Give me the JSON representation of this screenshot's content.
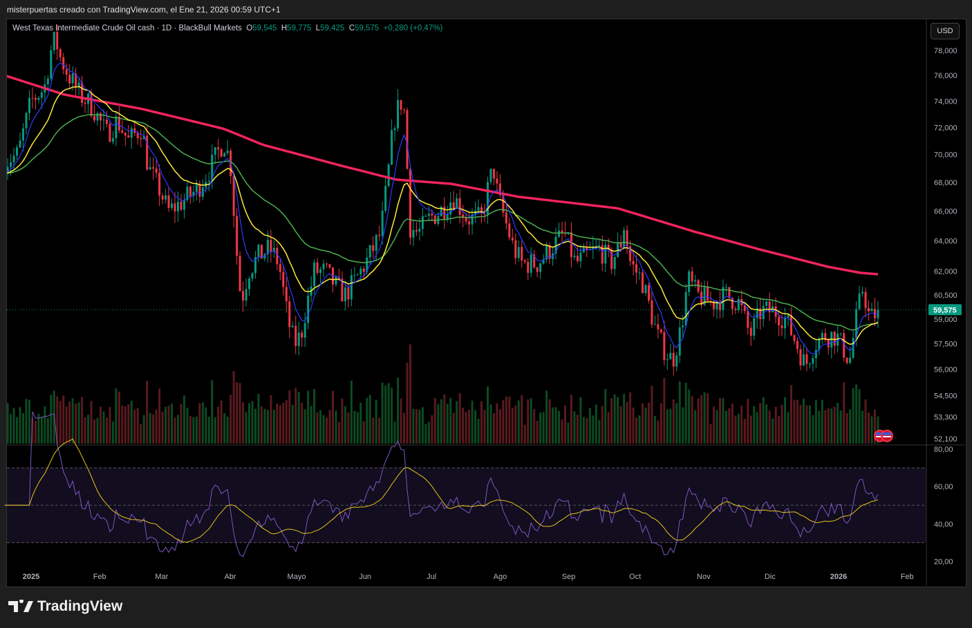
{
  "credit": "misterpuertas creado con TradingView.com, el Ene 21, 2026 00:59 UTC+1",
  "legend": {
    "title": "West Texas Intermediate Crude Oil cash · 1D · BlackBull Markets",
    "o_label": "O",
    "o": "59,545",
    "h_label": "H",
    "h": "59,775",
    "l_label": "L",
    "l": "59,425",
    "c_label": "C",
    "c": "59,575",
    "change": "+0,280 (+0,47%)"
  },
  "currency": "USD",
  "brand": "TradingView",
  "chart_data": {
    "type": "candlestick",
    "scale": "log",
    "last_price": 59.575,
    "last_price_label": "59,575",
    "price_ticks": [
      "78,000",
      "76,000",
      "74,000",
      "72,000",
      "70,000",
      "68,000",
      "66,000",
      "64,000",
      "62,000",
      "60,500",
      "59,000",
      "57,500",
      "56,000",
      "54,500",
      "53,300",
      "52,100"
    ],
    "price_tick_values": [
      78,
      76,
      74,
      72,
      70,
      68,
      66,
      64,
      62,
      60.5,
      59,
      57.5,
      56,
      54.5,
      53.3,
      52.1
    ],
    "rsi_ticks": [
      "80,00",
      "60,00",
      "40,00",
      "20,00"
    ],
    "rsi_tick_values": [
      80,
      60,
      40,
      20
    ],
    "rsi_bands": [
      70,
      50,
      30
    ],
    "time_labels": [
      "2025",
      "Feb",
      "Mar",
      "Abr",
      "Mayo",
      "Jun",
      "Jul",
      "Ago",
      "Sep",
      "Oct",
      "Nov",
      "Dic",
      "2026",
      "Feb"
    ],
    "time_label_days": [
      0,
      31,
      59,
      90,
      120,
      151,
      181,
      212,
      243,
      273,
      304,
      334,
      365,
      396
    ],
    "close_anchors": [
      [
        -12,
        69.5
      ],
      [
        -6,
        70
      ],
      [
        0,
        74
      ],
      [
        6,
        75
      ],
      [
        9,
        78
      ],
      [
        11,
        79
      ],
      [
        13,
        77.5
      ],
      [
        17,
        76
      ],
      [
        22,
        74.5
      ],
      [
        28,
        73.5
      ],
      [
        34,
        71.5
      ],
      [
        39,
        72.5
      ],
      [
        44,
        71
      ],
      [
        50,
        72
      ],
      [
        53,
        69
      ],
      [
        58,
        67.5
      ],
      [
        62,
        66
      ],
      [
        67,
        66.5
      ],
      [
        75,
        67.5
      ],
      [
        81,
        69
      ],
      [
        87,
        71
      ],
      [
        90,
        69.5
      ],
      [
        94,
        61
      ],
      [
        96,
        60.5
      ],
      [
        98,
        62
      ],
      [
        103,
        63
      ],
      [
        108,
        63.5
      ],
      [
        112,
        62.5
      ],
      [
        116,
        59
      ],
      [
        119,
        57.5
      ],
      [
        122,
        58
      ],
      [
        124,
        59.5
      ],
      [
        128,
        62
      ],
      [
        133,
        62
      ],
      [
        138,
        61
      ],
      [
        142,
        60.5
      ],
      [
        147,
        61.5
      ],
      [
        153,
        63
      ],
      [
        158,
        64.5
      ],
      [
        161,
        68
      ],
      [
        164,
        72.5
      ],
      [
        167,
        74
      ],
      [
        169,
        73
      ],
      [
        171,
        65
      ],
      [
        175,
        64.5
      ],
      [
        180,
        65.5
      ],
      [
        185,
        66
      ],
      [
        191,
        67
      ],
      [
        197,
        65.5
      ],
      [
        204,
        65.5
      ],
      [
        207,
        68
      ],
      [
        209,
        69
      ],
      [
        211,
        67
      ],
      [
        214,
        65.5
      ],
      [
        218,
        63.5
      ],
      [
        222,
        62.5
      ],
      [
        229,
        62.5
      ],
      [
        235,
        63.5
      ],
      [
        241,
        64.5
      ],
      [
        246,
        62.5
      ],
      [
        251,
        63
      ],
      [
        257,
        63.5
      ],
      [
        262,
        62.5
      ],
      [
        267,
        64
      ],
      [
        268,
        65
      ],
      [
        271,
        62.5
      ],
      [
        276,
        61.5
      ],
      [
        283,
        58
      ],
      [
        287,
        57
      ],
      [
        290,
        56.5
      ],
      [
        294,
        58.5
      ],
      [
        297,
        61.5
      ],
      [
        301,
        60.5
      ],
      [
        308,
        60
      ],
      [
        314,
        60.5
      ],
      [
        320,
        60
      ],
      [
        325,
        58
      ],
      [
        330,
        59.5
      ],
      [
        336,
        59.5
      ],
      [
        341,
        59
      ],
      [
        346,
        57.5
      ],
      [
        350,
        56.2
      ],
      [
        354,
        57.5
      ],
      [
        359,
        58
      ],
      [
        364,
        58
      ],
      [
        370,
        56.5
      ],
      [
        373,
        59
      ],
      [
        376,
        61
      ],
      [
        379,
        59
      ],
      [
        384,
        59.575
      ]
    ],
    "ma200_anchors": [
      [
        -12,
        76
      ],
      [
        15,
        74.5
      ],
      [
        50,
        73.4
      ],
      [
        87,
        71.9
      ],
      [
        105,
        70.7
      ],
      [
        140,
        69.2
      ],
      [
        165,
        68.2
      ],
      [
        190,
        67.9
      ],
      [
        220,
        67
      ],
      [
        265,
        66.2
      ],
      [
        300,
        64.6
      ],
      [
        330,
        63.4
      ],
      [
        360,
        62.3
      ],
      [
        375,
        61.9
      ],
      [
        384,
        61.8
      ]
    ]
  }
}
